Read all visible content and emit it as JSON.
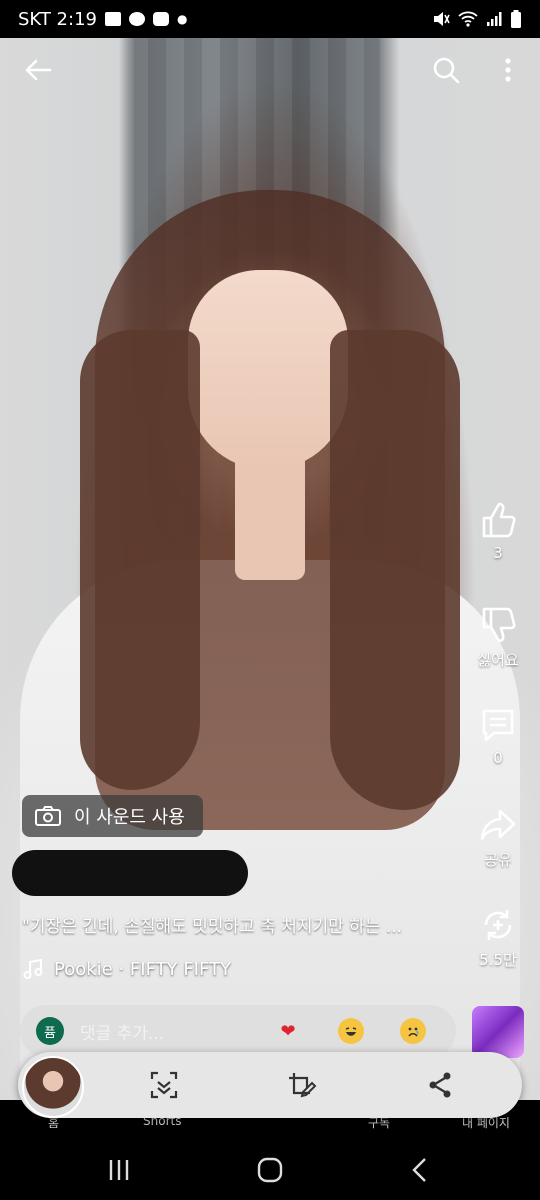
{
  "status_bar": {
    "carrier_time": "SKT 2:19",
    "icons_left": [
      "gallery-icon",
      "talk-icon",
      "youtube-icon",
      "dot-icon"
    ],
    "icons_right": [
      "mute-icon",
      "wifi-icon",
      "signal-icon",
      "battery-icon"
    ]
  },
  "top_bar": {
    "icons": [
      "back-arrow-icon",
      "search-icon",
      "more-vert-icon"
    ]
  },
  "actions": {
    "like_count": "3",
    "dislike_label": "싫어요",
    "comment_count": "0",
    "share_label": "공유",
    "remix_count": "5.5만"
  },
  "sound_chip": {
    "label": "이 사운드 사용",
    "icon": "camera-icon"
  },
  "caption": "\"기장은 긴데, 손질해도 밋밋하고 축 처지기만 하는 ...",
  "music": {
    "icon": "music-note-icon",
    "text": "Pookie · FIFTY FIFTY"
  },
  "comment_bar": {
    "avatar_text": "퓸",
    "placeholder": "댓글 추가...",
    "reactions": [
      "❤",
      "😆",
      "😢"
    ]
  },
  "bottom_nav": {
    "labels": [
      "홈",
      "Shorts",
      "구독",
      "내 페이지"
    ]
  },
  "floating_pill": {
    "icons": [
      "avatar",
      "scan-icon",
      "crop-edit-icon",
      "share-icon"
    ]
  },
  "system_nav": {
    "icons": [
      "recent-apps-icon",
      "home-icon",
      "back-icon"
    ]
  },
  "colors": {
    "accent_green": "#0e6b4f",
    "heart_red": "#e0242f",
    "pill_bg": "#e6e6e6"
  }
}
